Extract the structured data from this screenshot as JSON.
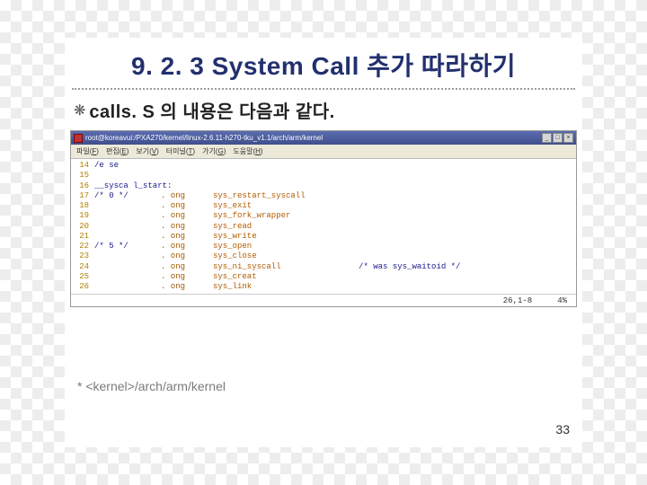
{
  "title": "9. 2. 3 System Call 추가 따라하기",
  "subtitle": "calls. S 의 내용은 다음과 같다.",
  "terminal": {
    "titlebar": "root@koreavui:/PXA270/kernel/linux-2.6.11-h270-tku_v1.1/arch/arm/kernel",
    "winbtns": {
      "min": "_",
      "max": "□",
      "close": "×"
    },
    "menus": [
      {
        "label": "파일",
        "accel": "F"
      },
      {
        "label": "편집",
        "accel": "E"
      },
      {
        "label": "보기",
        "accel": "V"
      },
      {
        "label": "터미널",
        "accel": "T"
      },
      {
        "label": "가기",
        "accel": "G"
      },
      {
        "label": "도움말",
        "accel": "H"
      }
    ],
    "lines": [
      {
        "n": "14",
        "c1": "/e se",
        "c2": "",
        "c3": ""
      },
      {
        "n": "15",
        "c1": "",
        "c2": "",
        "c3": ""
      },
      {
        "n": "16",
        "c1": "__sysca l_start:",
        "c2": "",
        "c3": ""
      },
      {
        "n": "17",
        "c1": "/* 0 */",
        "c2": ". ong",
        "c3": "sys_restart_syscall"
      },
      {
        "n": "18",
        "c1": "",
        "c2": ". ong",
        "c3": "sys_exit"
      },
      {
        "n": "19",
        "c1": "",
        "c2": ". ong",
        "c3": "sys_fork_wrapper"
      },
      {
        "n": "20",
        "c1": "",
        "c2": ". ong",
        "c3": "sys_read"
      },
      {
        "n": "21",
        "c1": "",
        "c2": ". ong",
        "c3": "sys_write"
      },
      {
        "n": "22",
        "c1": "/* 5 */",
        "c2": ". ong",
        "c3": "sys_open"
      },
      {
        "n": "23",
        "c1": "",
        "c2": ". ong",
        "c3": "sys_close"
      },
      {
        "n": "24",
        "c1": "",
        "c2": ". ong",
        "c3": "sys_ni_syscall",
        "cmt": "/* was sys_waitoid */"
      },
      {
        "n": "25",
        "c1": "",
        "c2": ". ong",
        "c3": "sys_creat"
      },
      {
        "n": "26",
        "c1": "",
        "c2": ". ong",
        "c3": "sys_link"
      }
    ],
    "status": {
      "pos": "26,1-8",
      "pct": "4%"
    }
  },
  "footnote": "* <kernel>/arch/arm/kernel",
  "pagenum": "33"
}
